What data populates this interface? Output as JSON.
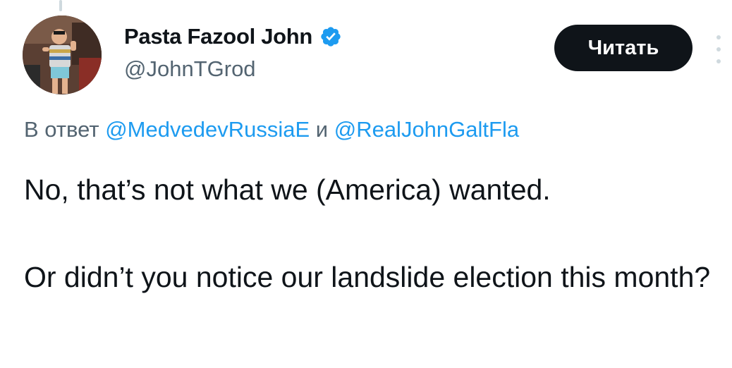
{
  "author": {
    "display_name": "Pasta Fazool John",
    "handle": "@JohnTGrod",
    "verified": true,
    "verified_icon": "verified-badge-icon",
    "avatar_icon": "profile-photo"
  },
  "actions": {
    "follow_label": "Читать",
    "more_icon": "more-vertical-icon"
  },
  "reply": {
    "prefix": "В ответ",
    "mention_1": "@MedvedevRussiaE",
    "conjunction": "и",
    "mention_2": "@RealJohnGaltFla"
  },
  "tweet": {
    "paragraph_1": "No, that’s not what we (America) wanted.",
    "paragraph_2": "Or didn’t you notice our landslide election this month?"
  },
  "colors": {
    "text": "#0f1419",
    "secondary": "#536471",
    "link": "#1d9bf0",
    "button_bg": "#0f1419",
    "button_text": "#ffffff",
    "verified": "#1d9bf0"
  }
}
